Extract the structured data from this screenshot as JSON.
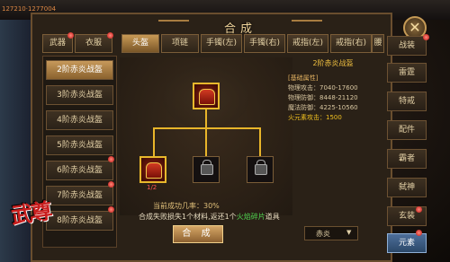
{
  "hud": {
    "top_text": "127210·1277004",
    "left_lines": [
      "",
      "",
      "",
      "",
      ""
    ]
  },
  "window": {
    "title": "合成",
    "close_icon": "close-icon"
  },
  "tabs": [
    {
      "label": "武器",
      "badge": true
    },
    {
      "label": "衣服",
      "badge": true
    },
    {
      "label": "头盔",
      "badge": false,
      "active": true
    },
    {
      "label": "项链",
      "badge": false
    },
    {
      "label": "手镯(左)",
      "badge": false
    },
    {
      "label": "手镯(右)",
      "badge": false
    },
    {
      "label": "戒指(左)",
      "badge": false
    },
    {
      "label": "戒指(右)",
      "badge": false
    },
    {
      "label": "腰",
      "badge": false
    }
  ],
  "list": [
    {
      "label": "2阶赤炎战盔",
      "selected": true
    },
    {
      "label": "3阶赤炎战盔"
    },
    {
      "label": "4阶赤炎战盔"
    },
    {
      "label": "5阶赤炎战盔"
    },
    {
      "label": "6阶赤炎战盔"
    },
    {
      "label": "7阶赤炎战盔"
    },
    {
      "label": "8阶赤炎战盔"
    }
  ],
  "recipe": {
    "result_icon": "helmet-icon",
    "material_qty": "1/2",
    "rate_text": "当前成功几率：30%",
    "fail_prefix": "合成失败损失1个材料,返还1个",
    "fail_highlight": "火焰碎片",
    "fail_suffix": "道具",
    "combine_label": "合 成"
  },
  "info": {
    "name": "2阶赤炎战盔",
    "lines": [
      {
        "text": "[基础属性]",
        "kind": "head"
      },
      {
        "text": "物理攻击：7040-17600",
        "kind": "normal"
      },
      {
        "text": "物理防御：8448-21120",
        "kind": "normal"
      },
      {
        "text": "魔法防御：4225-10560",
        "kind": "normal"
      },
      {
        "text": "火元素攻击：1500",
        "kind": "fire"
      }
    ]
  },
  "dropdown": {
    "value": "赤炎",
    "arrow": "▼"
  },
  "right_tabs": [
    {
      "label": "战装"
    },
    {
      "label": "雷霆"
    },
    {
      "label": "特戒"
    },
    {
      "label": "配件"
    },
    {
      "label": "霸者"
    },
    {
      "label": "弑神"
    },
    {
      "label": "玄装"
    },
    {
      "label": "元素",
      "active": true
    }
  ],
  "logo": {
    "text": "武尊"
  },
  "colors": {
    "accent": "#e8b82c",
    "highlight_green": "#4fd34f",
    "fire": "#f0c020"
  }
}
